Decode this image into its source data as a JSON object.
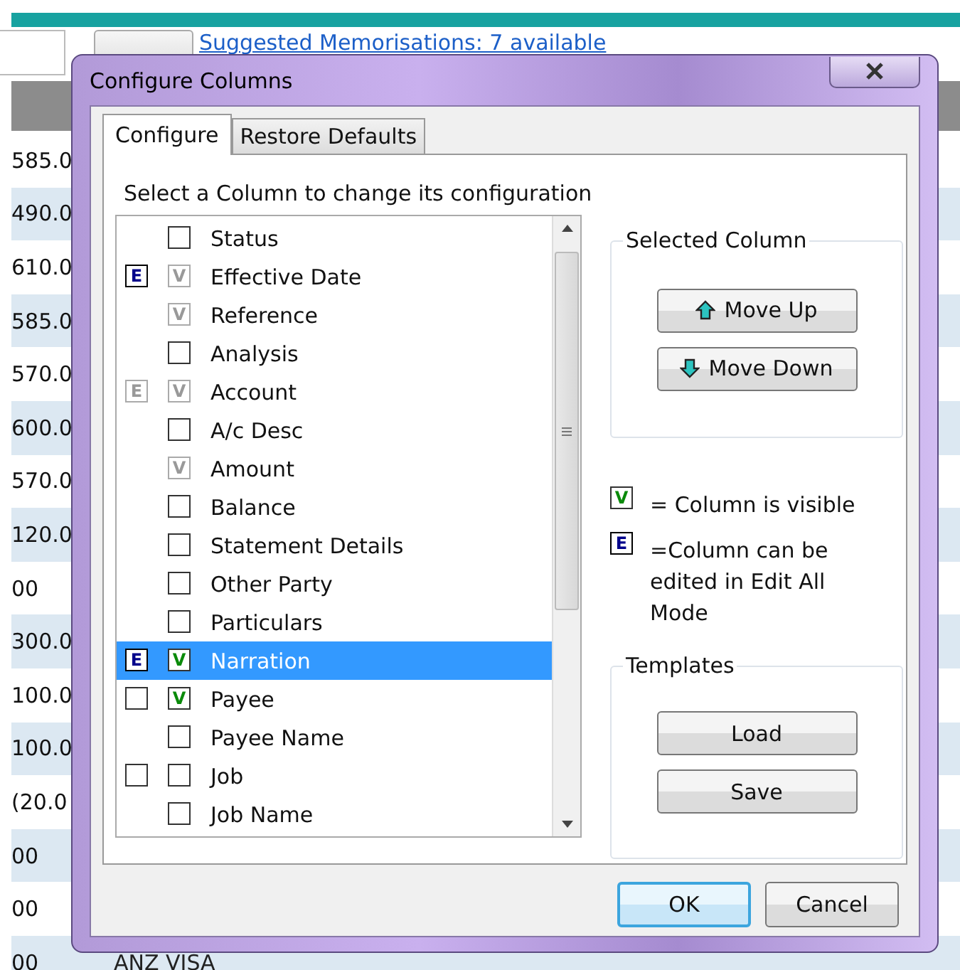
{
  "background": {
    "toolbar": {
      "suggestion_link": "Suggested Memorisations: 7 available"
    },
    "amounts": [
      "585.0",
      "490.0",
      "610.0",
      "585.0",
      "570.0",
      "600.0",
      "570.0",
      "120.0",
      "00",
      "300.0",
      "100.0",
      "100.0",
      "(20.0",
      "00",
      "00",
      "00"
    ],
    "footer_text": "ANZ VISA"
  },
  "dialog": {
    "title": "Configure Columns",
    "tabs": [
      {
        "label": "Configure",
        "selected": true
      },
      {
        "label": "Restore Defaults",
        "selected": false
      }
    ],
    "instruction": "Select a Column to change its configuration",
    "columns": [
      {
        "name": "Status",
        "editable": false,
        "visible_checked": false,
        "selected": false
      },
      {
        "name": "Effective Date",
        "editable": true,
        "edit_checked": true,
        "edit_mark": "E",
        "edit_enabled": true,
        "visible_checked": true,
        "visible_mark": "V",
        "visible_enabled": false,
        "selected": false
      },
      {
        "name": "Reference",
        "editable": false,
        "visible_checked": true,
        "visible_mark": "V",
        "visible_enabled": false,
        "selected": false
      },
      {
        "name": "Analysis",
        "editable": false,
        "visible_checked": false,
        "selected": false
      },
      {
        "name": "Account",
        "editable": true,
        "edit_checked": true,
        "edit_mark": "E",
        "edit_enabled": false,
        "visible_checked": true,
        "visible_mark": "V",
        "visible_enabled": false,
        "selected": false
      },
      {
        "name": "A/c Desc",
        "editable": false,
        "visible_checked": false,
        "selected": false
      },
      {
        "name": "Amount",
        "editable": false,
        "visible_checked": true,
        "visible_mark": "V",
        "visible_enabled": false,
        "selected": false
      },
      {
        "name": "Balance",
        "editable": false,
        "visible_checked": false,
        "selected": false
      },
      {
        "name": "Statement Details",
        "editable": false,
        "visible_checked": false,
        "selected": false
      },
      {
        "name": "Other Party",
        "editable": false,
        "visible_checked": false,
        "selected": false
      },
      {
        "name": "Particulars",
        "editable": false,
        "visible_checked": false,
        "selected": false
      },
      {
        "name": "Narration",
        "editable": true,
        "edit_checked": true,
        "edit_mark": "E",
        "edit_enabled": true,
        "visible_checked": true,
        "visible_mark": "V",
        "visible_enabled": true,
        "selected": true
      },
      {
        "name": "Payee",
        "editable": true,
        "edit_checked": false,
        "visible_checked": true,
        "visible_mark": "V",
        "visible_enabled": true,
        "selected": false
      },
      {
        "name": "Payee Name",
        "editable": false,
        "visible_checked": false,
        "selected": false
      },
      {
        "name": "Job",
        "editable": true,
        "edit_checked": false,
        "visible_checked": false,
        "selected": false
      },
      {
        "name": "Job Name",
        "editable": false,
        "visible_checked": false,
        "selected": false
      }
    ],
    "selected_column": {
      "title": "Selected Column",
      "buttons": [
        {
          "kind": "up",
          "label": "Move Up"
        },
        {
          "kind": "down",
          "label": "Move Down"
        }
      ]
    },
    "legend": [
      {
        "kind": "visible",
        "mark": "V",
        "text": "= Column is visible"
      },
      {
        "kind": "edit",
        "mark": "E",
        "text": "=Column can be edited in Edit All Mode"
      }
    ],
    "templates": {
      "title": "Templates",
      "buttons": [
        {
          "label": "Load"
        },
        {
          "label": "Save"
        }
      ]
    },
    "buttons": [
      {
        "label": "OK",
        "default": true
      },
      {
        "label": "Cancel",
        "default": false
      }
    ]
  }
}
